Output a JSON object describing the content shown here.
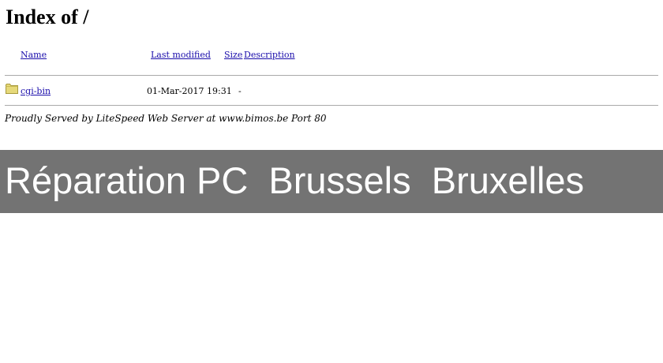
{
  "header": {
    "title": "Index of /"
  },
  "table": {
    "columns": {
      "name": "Name",
      "last_modified": "Last modified",
      "size": "Size",
      "description": "Description"
    },
    "rows": [
      {
        "icon": "folder-icon",
        "name": "cgi-bin",
        "last_modified": "01-Mar-2017 19:31",
        "size": "-"
      }
    ]
  },
  "footer": {
    "text": "Proudly Served by LiteSpeed Web Server at www.bimos.be Port 80"
  },
  "banner": {
    "text": "Réparation PC  Brussels  Bruxelles",
    "background": "#737373",
    "text_color": "#ffffff"
  },
  "colors": {
    "link": "#1a0dab",
    "folder_fill": "#e6d97a",
    "folder_stroke": "#a89a3c"
  }
}
